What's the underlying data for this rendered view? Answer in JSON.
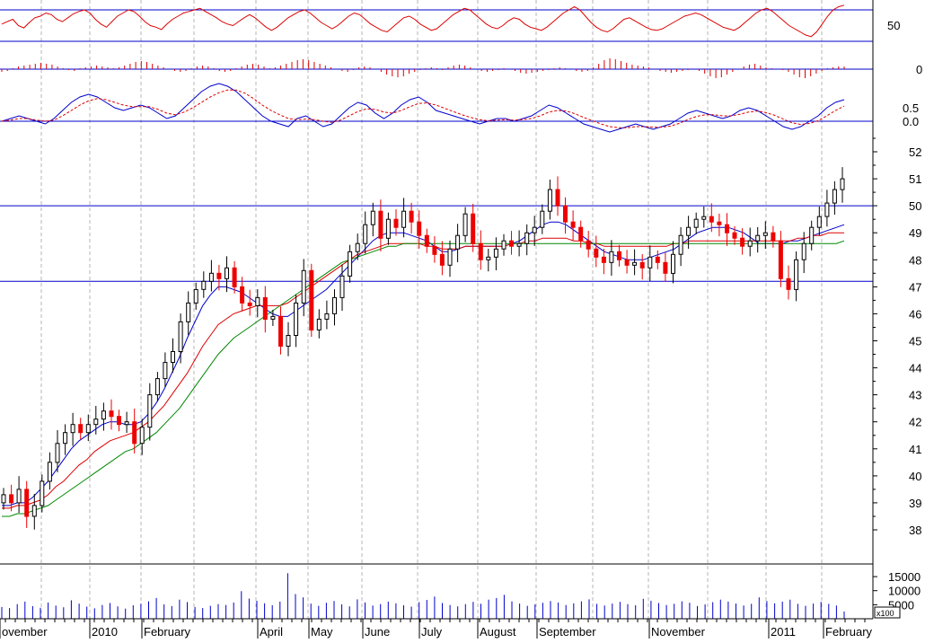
{
  "colors": {
    "background": "#ffffff",
    "grid": "#b4b4b4",
    "level_line": "#0000cc",
    "rsi": "#dd0000",
    "histogram": "#dd0000",
    "macd_line": "#0000cc",
    "macd_signal": "#dd0000",
    "candle_up": "#000000",
    "candle_down": "#ee0000",
    "ma_short": "#0000cc",
    "ma_mid": "#dd0000",
    "ma_long": "#008800",
    "volume": "#0000cc",
    "axis": "#000000"
  },
  "chart_data": [
    {
      "type": "line",
      "name": "oscillator-panel",
      "yticks": [
        "50"
      ],
      "levels": [
        70,
        30
      ],
      "ylim": [
        20,
        80
      ],
      "values": [
        52,
        55,
        58,
        50,
        47,
        54,
        60,
        62,
        66,
        64,
        58,
        55,
        60,
        65,
        68,
        70,
        66,
        58,
        52,
        48,
        55,
        62,
        66,
        70,
        68,
        62,
        55,
        50,
        48,
        45,
        52,
        58,
        62,
        66,
        68,
        70,
        72,
        68,
        64,
        60,
        55,
        52,
        50,
        55,
        60,
        64,
        60,
        54,
        48,
        44,
        48,
        54,
        60,
        64,
        68,
        70,
        66,
        60,
        54,
        50,
        46,
        50,
        56,
        62,
        66,
        64,
        58,
        52,
        48,
        44,
        42,
        48,
        54,
        60,
        62,
        58,
        52,
        48,
        44,
        46,
        52,
        58,
        64,
        68,
        72,
        70,
        64,
        58,
        52,
        48,
        46,
        50,
        56,
        60,
        58,
        52,
        48,
        46,
        44,
        48,
        54,
        60,
        66,
        70,
        74,
        70,
        62,
        54,
        48,
        44,
        42,
        46,
        52,
        58,
        60,
        56,
        52,
        48,
        45,
        44,
        46,
        50,
        54,
        58,
        62,
        64,
        66,
        64,
        60,
        56,
        52,
        48,
        46,
        44,
        48,
        54,
        60,
        66,
        70,
        72,
        68,
        62,
        56,
        50,
        46,
        42,
        38,
        36,
        42,
        52,
        62,
        70,
        74,
        76
      ]
    },
    {
      "type": "bar",
      "name": "histogram-panel",
      "yticks": [
        "0"
      ],
      "values": [
        -0.3,
        -0.2,
        0.1,
        0.3,
        0.4,
        0.5,
        0.6,
        0.7,
        0.6,
        0.5,
        0.3,
        0.1,
        -0.1,
        -0.2,
        0.1,
        0.2,
        0.3,
        0.4,
        0.3,
        0.2,
        0.1,
        0.2,
        0.4,
        0.6,
        0.8,
        0.9,
        0.8,
        0.6,
        0.4,
        0.2,
        0,
        -0.2,
        -0.3,
        -0.2,
        0.1,
        0.3,
        0.4,
        0.3,
        0.1,
        -0.2,
        -0.3,
        -0.2,
        0.1,
        0.3,
        0.5,
        0.6,
        0.5,
        0.3,
        0.1,
        0.2,
        0.4,
        0.6,
        0.8,
        1,
        1.1,
        1,
        0.8,
        0.6,
        0.4,
        0.2,
        0,
        -0.2,
        -0.3,
        -0.1,
        0.2,
        0.3,
        0.2,
        0,
        -0.3,
        -0.6,
        -0.8,
        -0.9,
        -0.8,
        -0.5,
        -0.3,
        -0.1,
        0.1,
        0.2,
        0.1,
        -0.1,
        0.2,
        0.4,
        0.5,
        0.4,
        0.2,
        0,
        -0.2,
        -0.3,
        -0.2,
        -0.1,
        0.1,
        0,
        -0.2,
        -0.4,
        -0.5,
        -0.4,
        -0.3,
        -0.2,
        -0.1,
        0.1,
        0.2,
        0.1,
        0,
        -0.2,
        -0.3,
        -0.2,
        0.2,
        0.6,
        1,
        1.2,
        1.1,
        0.9,
        0.7,
        0.5,
        0.4,
        0.3,
        0.2,
        0,
        -0.2,
        -0.3,
        -0.4,
        -0.3,
        -0.2,
        -0.1,
        0,
        -0.2,
        -0.5,
        -0.8,
        -1,
        -0.9,
        -0.6,
        -0.3,
        0,
        0.3,
        0.5,
        0.6,
        0.4,
        0.2,
        0.1,
        0,
        -0.1,
        -0.3,
        -0.6,
        -0.9,
        -1,
        -0.8,
        -0.5,
        -0.2,
        0.1,
        0.2,
        0.3,
        0.3
      ]
    },
    {
      "type": "line",
      "name": "macd-panel",
      "yticks": [
        "0.5",
        "0.0"
      ],
      "ylim": [
        -0.5,
        1.0
      ],
      "series": [
        {
          "values": [
            0,
            0.05,
            0.1,
            0.05,
            0,
            -0.05,
            0.05,
            0.2,
            0.35,
            0.45,
            0.5,
            0.45,
            0.35,
            0.25,
            0.2,
            0.25,
            0.3,
            0.25,
            0.15,
            0.05,
            0.1,
            0.25,
            0.4,
            0.55,
            0.65,
            0.7,
            0.65,
            0.55,
            0.4,
            0.25,
            0.1,
            0,
            -0.05,
            -0.1,
            0.05,
            0.1,
            0,
            -0.1,
            -0.05,
            0.1,
            0.25,
            0.35,
            0.3,
            0.15,
            0.05,
            0.15,
            0.3,
            0.4,
            0.45,
            0.35,
            0.2,
            0.15,
            0.1,
            0.05,
            0,
            -0.05,
            0,
            0.05,
            0.05,
            0,
            0.05,
            0.1,
            0.2,
            0.3,
            0.25,
            0.15,
            0.05,
            -0.05,
            -0.1,
            -0.15,
            -0.2,
            -0.15,
            -0.1,
            -0.05,
            -0.1,
            -0.15,
            -0.1,
            -0.05,
            0.05,
            0.15,
            0.2,
            0.15,
            0.1,
            0.05,
            0.1,
            0.2,
            0.25,
            0.2,
            0.1,
            0,
            -0.1,
            -0.15,
            -0.1,
            0,
            0.1,
            0.25,
            0.35,
            0.4
          ]
        },
        {
          "values": [
            0,
            0.02,
            0.05,
            0.05,
            0.02,
            0,
            0.02,
            0.1,
            0.2,
            0.3,
            0.38,
            0.42,
            0.4,
            0.35,
            0.3,
            0.27,
            0.27,
            0.27,
            0.22,
            0.15,
            0.12,
            0.17,
            0.25,
            0.35,
            0.45,
            0.53,
            0.58,
            0.58,
            0.52,
            0.42,
            0.3,
            0.2,
            0.12,
            0.05,
            0.03,
            0.04,
            0.03,
            0,
            -0.02,
            0.02,
            0.1,
            0.18,
            0.23,
            0.22,
            0.17,
            0.15,
            0.2,
            0.27,
            0.33,
            0.34,
            0.3,
            0.24,
            0.18,
            0.12,
            0.07,
            0.03,
            0.01,
            0.02,
            0.03,
            0.02,
            0.03,
            0.05,
            0.1,
            0.17,
            0.2,
            0.19,
            0.14,
            0.07,
            0.01,
            -0.05,
            -0.1,
            -0.12,
            -0.12,
            -0.1,
            -0.1,
            -0.11,
            -0.11,
            -0.09,
            -0.04,
            0.03,
            0.09,
            0.12,
            0.12,
            0.1,
            0.1,
            0.13,
            0.17,
            0.19,
            0.16,
            0.11,
            0.04,
            -0.03,
            -0.06,
            -0.04,
            0.01,
            0.1,
            0.2,
            0.28
          ]
        }
      ]
    },
    {
      "type": "candlestick",
      "name": "price-panel",
      "yticks": [
        "38",
        "39",
        "40",
        "41",
        "42",
        "43",
        "44",
        "45",
        "46",
        "47",
        "48",
        "49",
        "50",
        "51",
        "52"
      ],
      "ylim": [
        37.2,
        52.6
      ],
      "levels": [
        50,
        47.2
      ],
      "xticks": [
        "ovember",
        "2010",
        "February",
        "April",
        "May",
        "June",
        "July",
        "August",
        "September",
        "November",
        "2011",
        "February"
      ],
      "close": [
        39.3,
        39.0,
        39.5,
        38.5,
        38.9,
        39.8,
        40.5,
        41.2,
        41.6,
        41.9,
        41.6,
        41.9,
        42.1,
        42.4,
        42.2,
        41.9,
        42.0,
        41.2,
        41.8,
        43.0,
        43.6,
        44.2,
        44.6,
        45.7,
        46.4,
        46.9,
        47.2,
        47.5,
        47.3,
        47.7,
        47.0,
        46.4,
        46.3,
        46.6,
        45.8,
        45.9,
        44.8,
        45.2,
        46.4,
        47.6,
        45.4,
        45.8,
        46.0,
        46.6,
        47.4,
        48.3,
        48.6,
        49.3,
        49.8,
        48.8,
        49.5,
        49.2,
        49.8,
        49.4,
        48.9,
        48.5,
        48.2,
        47.8,
        48.4,
        48.9,
        49.7,
        48.6,
        48.0,
        48.1,
        48.4,
        48.7,
        48.5,
        48.6,
        49.0,
        49.2,
        49.8,
        50.6,
        50.0,
        49.4,
        49.2,
        48.7,
        48.4,
        48.1,
        47.9,
        48.3,
        48.0,
        47.8,
        47.9,
        47.7,
        48.1,
        47.9,
        47.5,
        48.2,
        48.9,
        49.2,
        49.5,
        49.6,
        49.4,
        49.3,
        49.0,
        48.8,
        48.5,
        48.7,
        48.9,
        49.0,
        48.7,
        47.3,
        46.9,
        48.0,
        48.6,
        49.2,
        49.6,
        50.1,
        50.6,
        51.0
      ],
      "series": [
        {
          "name": "",
          "values": [
            38.9,
            38.9,
            39.0,
            39.0,
            39.2,
            39.5,
            39.8,
            40.2,
            40.6,
            41.0,
            41.3,
            41.5,
            41.7,
            41.9,
            42.0,
            42.0,
            41.9,
            41.9,
            42.0,
            42.3,
            42.7,
            43.2,
            43.8,
            44.4,
            45.1,
            45.7,
            46.3,
            46.7,
            47.0,
            47.0,
            46.9,
            46.8,
            46.6,
            46.4,
            46.2,
            46.0,
            45.9,
            45.9,
            46.1,
            46.3,
            46.5,
            46.7,
            46.9,
            47.2,
            47.5,
            47.8,
            48.1,
            48.4,
            48.7,
            48.9,
            49.0,
            49.0,
            49.0,
            48.9,
            48.8,
            48.7,
            48.5,
            48.3,
            48.3,
            48.4,
            48.5,
            48.5,
            48.5,
            48.5,
            48.5,
            48.5,
            48.6,
            48.7,
            48.9,
            49.1,
            49.3,
            49.4,
            49.4,
            49.3,
            49.1,
            48.9,
            48.7,
            48.5,
            48.3,
            48.2,
            48.1,
            48.0,
            48.0,
            48.0,
            48.1,
            48.2,
            48.3,
            48.4,
            48.6,
            48.8,
            49.0,
            49.1,
            49.2,
            49.2,
            49.2,
            49.1,
            49.0,
            48.8,
            48.6,
            48.6,
            48.6,
            48.6,
            48.7,
            48.7,
            48.8,
            48.9,
            49.0,
            49.1,
            49.2,
            49.3
          ]
        },
        {
          "name": "",
          "values": [
            38.8,
            38.8,
            38.9,
            38.9,
            39.0,
            39.1,
            39.3,
            39.6,
            39.8,
            40.1,
            40.4,
            40.6,
            40.9,
            41.1,
            41.3,
            41.4,
            41.5,
            41.6,
            41.8,
            42.0,
            42.3,
            42.6,
            43.0,
            43.4,
            43.8,
            44.3,
            44.8,
            45.2,
            45.6,
            45.8,
            46.0,
            46.1,
            46.2,
            46.3,
            46.3,
            46.3,
            46.3,
            46.4,
            46.6,
            46.8,
            47.0,
            47.2,
            47.4,
            47.6,
            47.8,
            48.0,
            48.2,
            48.3,
            48.4,
            48.5,
            48.6,
            48.6,
            48.6,
            48.6,
            48.6,
            48.5,
            48.5,
            48.4,
            48.4,
            48.4,
            48.5,
            48.5,
            48.5,
            48.5,
            48.5,
            48.5,
            48.6,
            48.6,
            48.7,
            48.7,
            48.8,
            48.8,
            48.8,
            48.8,
            48.7,
            48.7,
            48.6,
            48.6,
            48.5,
            48.5,
            48.5,
            48.5,
            48.5,
            48.5,
            48.5,
            48.5,
            48.5,
            48.6,
            48.6,
            48.7,
            48.7,
            48.7,
            48.7,
            48.7,
            48.7,
            48.7,
            48.7,
            48.7,
            48.7,
            48.7,
            48.7,
            48.7,
            48.7,
            48.8,
            48.8,
            48.9,
            48.9,
            49.0,
            49.0,
            49.0
          ]
        },
        {
          "name": "",
          "values": [
            38.5,
            38.5,
            38.6,
            38.6,
            38.7,
            38.8,
            38.9,
            39.1,
            39.3,
            39.5,
            39.7,
            39.9,
            40.1,
            40.3,
            40.5,
            40.7,
            40.9,
            41.0,
            41.2,
            41.4,
            41.6,
            41.9,
            42.2,
            42.5,
            42.9,
            43.3,
            43.7,
            44.1,
            44.5,
            44.8,
            45.1,
            45.3,
            45.5,
            45.7,
            45.9,
            46.1,
            46.3,
            46.5,
            46.7,
            46.9,
            47.1,
            47.3,
            47.5,
            47.7,
            47.9,
            48.0,
            48.1,
            48.2,
            48.3,
            48.4,
            48.5,
            48.5,
            48.6,
            48.6,
            48.6,
            48.6,
            48.6,
            48.6,
            48.6,
            48.6,
            48.6,
            48.6,
            48.6,
            48.6,
            48.6,
            48.6,
            48.6,
            48.6,
            48.6,
            48.6,
            48.6,
            48.6,
            48.6,
            48.6,
            48.6,
            48.6,
            48.6,
            48.6,
            48.6,
            48.6,
            48.6,
            48.6,
            48.6,
            48.6,
            48.6,
            48.6,
            48.6,
            48.6,
            48.6,
            48.6,
            48.6,
            48.6,
            48.6,
            48.6,
            48.6,
            48.6,
            48.6,
            48.6,
            48.6,
            48.6,
            48.6,
            48.6,
            48.6,
            48.6,
            48.6,
            48.6,
            48.6,
            48.6,
            48.6,
            48.7
          ]
        }
      ]
    },
    {
      "type": "bar",
      "name": "volume-panel",
      "yticks": [
        "15000",
        "10000",
        "5000"
      ],
      "scale_label": "x100",
      "ylim": [
        0,
        19500
      ],
      "values": [
        4200,
        3800,
        5200,
        6100,
        4500,
        3900,
        5800,
        4700,
        4100,
        6600,
        5400,
        4300,
        3700,
        4900,
        5600,
        4400,
        3600,
        4800,
        5300,
        6200,
        7400,
        5100,
        4500,
        6800,
        5900,
        4200,
        3800,
        4600,
        5200,
        4900,
        5800,
        9800,
        7200,
        6400,
        5500,
        4800,
        6100,
        16200,
        8800,
        7600,
        5400,
        4600,
        5700,
        6300,
        5100,
        4400,
        6900,
        5800,
        4700,
        5200,
        6100,
        5500,
        4800,
        4300,
        5900,
        6700,
        7900,
        5600,
        4900,
        4400,
        5200,
        6000,
        5300,
        6800,
        7400,
        8500,
        6200,
        5400,
        4600,
        5100,
        5700,
        6300,
        5800,
        4900,
        5500,
        6200,
        6900,
        5300,
        4700,
        5400,
        6000,
        5200,
        4800,
        7100,
        6400,
        5600,
        4900,
        5300,
        6200,
        5700,
        4500,
        5100,
        5900,
        6800,
        6100,
        5400,
        4700,
        5300,
        7600,
        6300,
        5500,
        6100,
        6800,
        5300,
        4600,
        5400,
        6000,
        5300,
        4700,
        2600
      ]
    }
  ]
}
